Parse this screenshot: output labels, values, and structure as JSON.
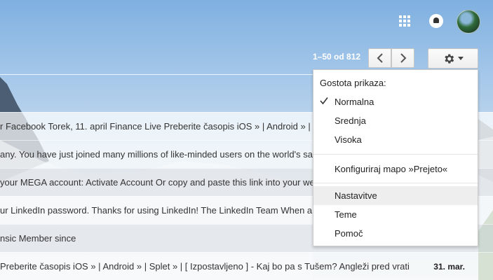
{
  "topbar": {
    "apps_icon": "apps-grid-icon",
    "notifications_icon": "bell-icon",
    "avatar": "account-avatar"
  },
  "toolbar": {
    "page_count": "1–50 od 812",
    "prev_icon": "chevron-left-icon",
    "next_icon": "chevron-right-icon",
    "settings_icon": "gear-icon"
  },
  "emails": [
    {
      "snippet": "r Facebook Torek, 11. april Finance Live Preberite časopis iOS » | Android » | S",
      "date": ""
    },
    {
      "snippet": "any. You have just joined many millions of like-minded users on the world's safe",
      "date": ""
    },
    {
      "snippet": "your MEGA account: Activate Account Or copy and paste this link into your we",
      "date": ""
    },
    {
      "snippet": "ur LinkedIn password. Thanks for using LinkedIn! The LinkedIn Team When an",
      "date": ""
    },
    {
      "snippet": "nsic Member since",
      "date": ""
    },
    {
      "snippet": "Preberite časopis iOS » | Android » | Splet » | [ Izpostavljeno ] - Kaj bo pa s Tušem? Angleži pred vrati",
      "date": "31. mar."
    }
  ],
  "menu": {
    "density_header": "Gostota prikaza:",
    "density_options": [
      {
        "label": "Normalna",
        "selected": true
      },
      {
        "label": "Srednja",
        "selected": false
      },
      {
        "label": "Visoka",
        "selected": false
      }
    ],
    "configure_inbox": "Konfiguriraj mapo »Prejeto«",
    "settings": "Nastavitve",
    "themes": "Teme",
    "help": "Pomoč"
  }
}
